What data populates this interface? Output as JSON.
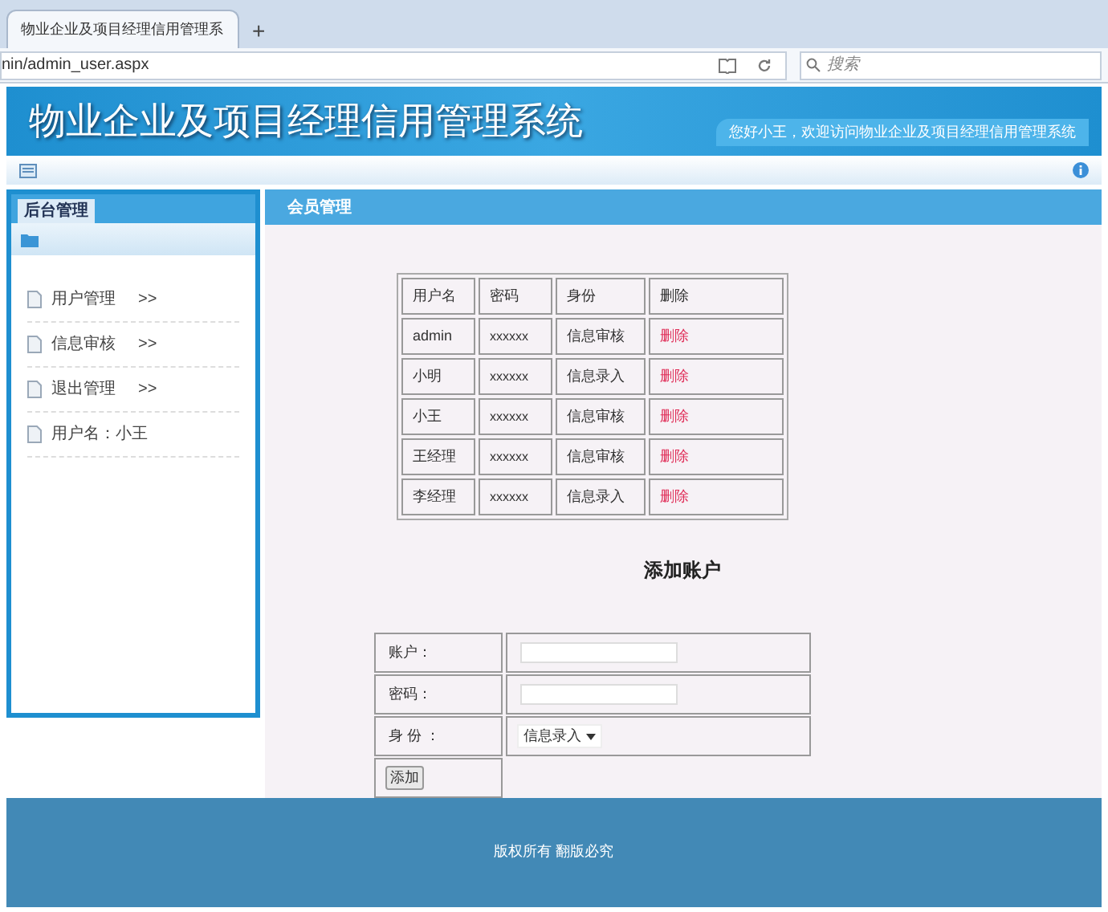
{
  "browser": {
    "tab_title": "物业企业及项目经理信用管理系",
    "new_tab": "+",
    "url": "nin/admin_user.aspx",
    "search_placeholder": "搜索"
  },
  "header": {
    "title": "物业企业及项目经理信用管理系统",
    "welcome": "您好小王，欢迎访问物业企业及项目经理信用管理系统"
  },
  "sidebar": {
    "tab": "后台管理",
    "items": [
      {
        "label": "用户管理",
        "arrow": ">>"
      },
      {
        "label": "信息审核",
        "arrow": ">>"
      },
      {
        "label": "退出管理",
        "arrow": ">>"
      },
      {
        "label": "用户名：小王"
      }
    ]
  },
  "content": {
    "title": "会员管理",
    "table": {
      "columns": [
        "用户名",
        "密码",
        "身份",
        "删除"
      ],
      "rows": [
        {
          "name": "admin",
          "password": "xxxxxx",
          "role": "信息审核",
          "action": "删除"
        },
        {
          "name": "小明",
          "password": "xxxxxx",
          "role": "信息录入",
          "action": "删除"
        },
        {
          "name": "小王",
          "password": "xxxxxx",
          "role": "信息审核",
          "action": "删除"
        },
        {
          "name": "王经理",
          "password": "xxxxxx",
          "role": "信息审核",
          "action": "删除"
        },
        {
          "name": "李经理",
          "password": "xxxxxx",
          "role": "信息录入",
          "action": "删除"
        }
      ]
    },
    "form": {
      "title": "添加账户",
      "account_label": "账户：",
      "password_label": "密码：",
      "role_label": "身 份 ：",
      "role_value": "信息录入",
      "submit": "添加"
    }
  },
  "footer": {
    "text": "版权所有 翻版必究"
  }
}
